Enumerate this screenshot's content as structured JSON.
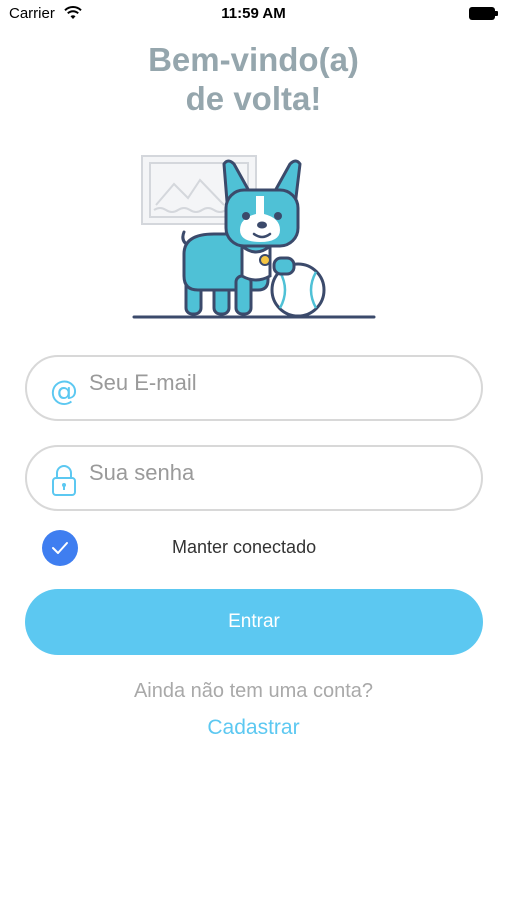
{
  "status_bar": {
    "carrier": "Carrier",
    "time": "11:59 AM",
    "icons": [
      "wifi-icon",
      "battery-icon"
    ]
  },
  "title": {
    "line1": "Bem-vindo(a)",
    "line2": "de volta!"
  },
  "illustration": {
    "name": "dog-with-ball-illustration",
    "colors": {
      "teal": "#4fc1d6",
      "outline": "#3b4a6b",
      "frame": "#d4d7dc"
    }
  },
  "form": {
    "email": {
      "placeholder": "Seu E-mail",
      "value": "",
      "icon": "at-icon"
    },
    "password": {
      "placeholder": "Sua senha",
      "value": "",
      "icon": "lock-icon"
    },
    "keep_connected": {
      "label": "Manter conectado",
      "checked": true
    },
    "submit_label": "Entrar"
  },
  "footer": {
    "question": "Ainda não tem uma conta?",
    "signup_label": "Cadastrar"
  },
  "colors": {
    "accent": "#5cc8f1",
    "checkbox": "#3f7ef0",
    "title": "#95a6ad",
    "placeholder": "#9a9a9a"
  }
}
